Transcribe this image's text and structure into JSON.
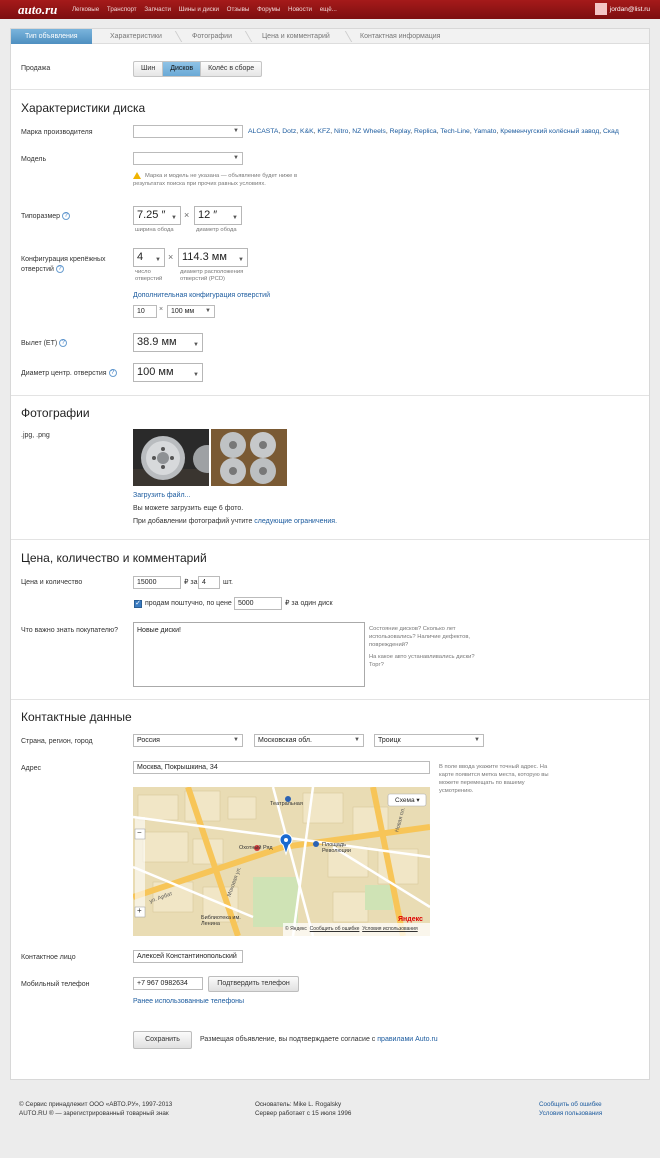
{
  "topbar": {
    "logo": "auto.ru",
    "nav": [
      "Легковые",
      "Транспорт",
      "Запчасти",
      "Шины и диски",
      "Отзывы",
      "Форумы",
      "Новости",
      "ещё..."
    ],
    "user": "jordan@list.ru"
  },
  "steps": [
    "Тип объявления",
    "Характеристики",
    "Фотографии",
    "Цена и комментарий",
    "Контактная информация"
  ],
  "sale": {
    "label": "Продажа",
    "options": [
      "Шин",
      "Дисков",
      "Колёс в сборе"
    ],
    "selected": "Дисков"
  },
  "disk": {
    "title": "Характеристики диска",
    "brand_label": "Марка производителя",
    "brand_value": "",
    "brands": [
      "ALCASTA",
      "Dotz",
      "K&K",
      "KFZ",
      "Nitro",
      "NZ Wheels",
      "Replay",
      "Replica",
      "Tech-Line",
      "Yamato",
      "Кременчугский колёсный завод",
      "Скад"
    ],
    "model_label": "Модель",
    "model_value": "",
    "model_hint": "Марка и модель не указана — объявление будет ниже в результатах поиска при прочих равных условиях.",
    "size_label": "Типоразмер",
    "width_value": "7.25 ″",
    "width_caption": "ширина обода",
    "diameter_value": "12 ″",
    "diameter_caption": "диаметр обода",
    "bolt_label": "Конфигурация крепёжных отверстий",
    "holes_value": "4",
    "holes_caption": "число отверстий",
    "pcd_value": "114.3 мм",
    "pcd_caption": "диаметр расположения отверстий (PCD)",
    "extra_link": "Дополнительная конфигурация отверстий",
    "extra_holes": "10",
    "extra_pcd": "100 мм",
    "offset_label": "Вылет (ET)",
    "offset_value": "38.9 мм",
    "center_label": "Диаметр центр. отверстия",
    "center_value": "100 мм",
    "times": "×"
  },
  "photos": {
    "title": "Фотографии",
    "formats": ".jpg, .png",
    "upload_link": "Загрузить файл...",
    "remaining": "Вы можете загрузить еще 6 фото.",
    "limits_text": "При добавлении фотографий учтите",
    "limits_link": "следующие ограничения."
  },
  "price": {
    "title": "Цена, количество и комментарий",
    "label": "Цена и количество",
    "price_value": "15000",
    "currency_for": "₽ за",
    "qty_value": "4",
    "unit": "шт.",
    "piece_label": "продам поштучно, по цене",
    "piece_value": "5000",
    "piece_unit": "₽ за один диск",
    "comment_label": "Что важно знать покупателю?",
    "comment_value": "Новые диски!",
    "comment_hint1": "Состояние дисков? Сколько лет использовались? Наличие дефектов, повреждений?",
    "comment_hint2": "На какое авто устанавливались диски? Торг?"
  },
  "contacts": {
    "title": "Контактные данные",
    "region_label": "Страна, регион, город",
    "country": "Россия",
    "region": "Московская обл.",
    "city": "Троицк",
    "address_label": "Адрес",
    "address_value": "Москва, Покрышкина, 34",
    "address_hint": "В поле ввода укажите точный адрес. На карте появится метка места, которую вы можете перемещать по вашему усмотрению.",
    "map_type": "Схема",
    "map_labels": [
      "Театральная",
      "Охотный Ряд",
      "Площадь Революции",
      "Библиотека им. Ленина",
      "Моховая ул.",
      "ул. Арбат",
      "Новая пл."
    ],
    "map_copyright": "© Яндекс",
    "map_error": "Сообщить об ошибке",
    "map_terms": "Условия использования",
    "map_brand": "Яндекс",
    "person_label": "Контактное лицо",
    "person_value": "Алексей Константинопольский",
    "phone_label": "Мобильный телефон",
    "phone_value": "+7 967 0982634",
    "confirm_button": "Подтвердить телефон",
    "used_phones": "Ранее использованные телефоны"
  },
  "submit": {
    "button": "Сохранить",
    "agreement": "Размещая объявление, вы подтверждаете согласие с",
    "rules_link": "правилами Auto.ru"
  },
  "footer": {
    "copyright1": "© Сервис принадлежит ООО «АВТО.РУ», 1997-2013",
    "copyright2": "AUTO.RU ® — зарегистрированный товарный знак",
    "founder": "Основатель: Mike L. Rogalsky",
    "uptime": "Сервер работает с 15 июля 1996",
    "report": "Сообщить об ошибке",
    "terms": "Условия пользования"
  },
  "colors": {
    "brand": "#8f1515",
    "link": "#1a5a9e",
    "active_step": "#5d9ccb"
  }
}
